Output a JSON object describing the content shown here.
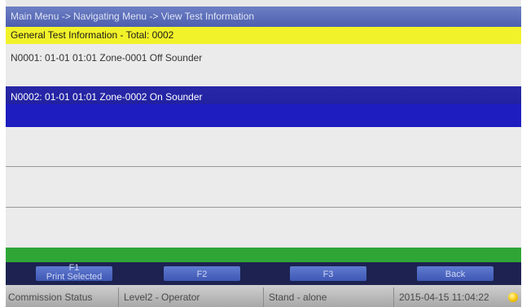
{
  "header": {
    "breadcrumb": "Main Menu -> Navigating Menu -> View Test Information"
  },
  "summary": {
    "text": "General Test Information - Total: 0002"
  },
  "records": [
    {
      "text": "N0001: 01-01 01:01 Zone-0001 Off Sounder",
      "selected": false
    },
    {
      "text": "N0002: 01-01 01:01 Zone-0002 On Sounder",
      "selected": true
    }
  ],
  "function_keys": [
    {
      "key": "F1",
      "label": "Print Selected"
    },
    {
      "key": "F2",
      "label": ""
    },
    {
      "key": "F3",
      "label": ""
    },
    {
      "key": "",
      "label": "Back"
    }
  ],
  "status_bar": {
    "mode": "Commission Status",
    "user_level": "Level2 - Operator",
    "network": "Stand - alone",
    "datetime": "2015-04-15 11:04:22"
  },
  "colors": {
    "title_bar": "#5a6cb8",
    "summary_bar": "#f2f22a",
    "selected_row": "#1d1dc0",
    "green_bar": "#2fa536",
    "function_bar": "#1d2250"
  },
  "icons": {
    "status_indicator": "status-indicator-icon"
  }
}
